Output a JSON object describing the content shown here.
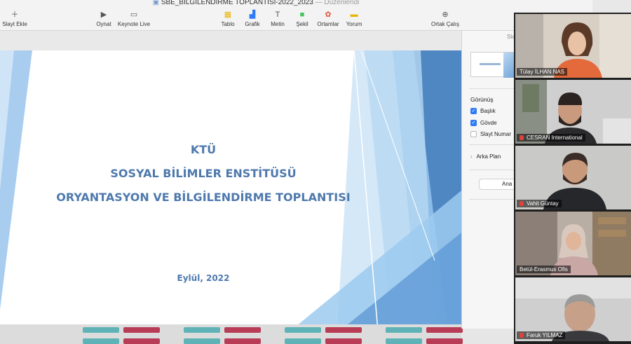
{
  "document": {
    "title": "SBE_BILGILENDIRME TOPLANTISI-2022_2023",
    "status": "— Düzenlendi"
  },
  "toolbar": {
    "add_slide": "Slayt Ekle",
    "play": "Oynat",
    "keynote_live": "Keynote Live",
    "table": "Tablo",
    "chart": "Grafik",
    "text": "Metin",
    "shape": "Şekil",
    "media": "Ortamlar",
    "comment": "Yorum",
    "collaborate": "Ortak Çalış"
  },
  "slide": {
    "line1": "KTÜ",
    "line2": "SOSYAL BİLİMLER ENSTİTÜSÜ",
    "line3": "ORYANTASYON VE BİLGİLENDİRME TOPLANTISI",
    "date": "Eylül, 2022",
    "accent_color": "#4e79ad"
  },
  "inspector": {
    "tab_label": "Sla",
    "view_label": "Görünüş",
    "checkboxes": [
      {
        "label": "Başlık",
        "checked": true
      },
      {
        "label": "Gövde",
        "checked": true
      },
      {
        "label": "Slayt Numar",
        "checked": false
      }
    ],
    "background_label": "Arka Plan",
    "master_button": "Ana"
  },
  "participants": [
    {
      "name": "Tülay İLHAN NAS",
      "muted": false,
      "active": false
    },
    {
      "name": "CESRAN International",
      "muted": true,
      "active": false
    },
    {
      "name": "Vahit Güntay",
      "muted": true,
      "active": false
    },
    {
      "name": "Betül-Erasmus Ofis",
      "muted": false,
      "active": true
    },
    {
      "name": "Faruk YILMAZ",
      "muted": true,
      "active": false
    }
  ]
}
